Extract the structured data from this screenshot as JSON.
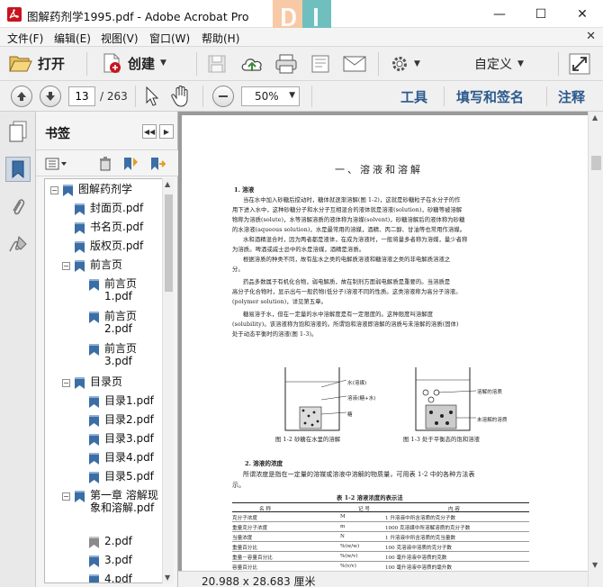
{
  "window": {
    "title": "图解药剂学1995.pdf - Adobe Acrobat Pro",
    "minimize": "—",
    "maximize": "☐",
    "close": "✕"
  },
  "menu": {
    "items": [
      "文件(F)",
      "编辑(E)",
      "视图(V)",
      "窗口(W)",
      "帮助(H)"
    ],
    "close": "✕"
  },
  "toolbar": {
    "open_label": "打开",
    "create_label": "创建",
    "customize_label": "自定义"
  },
  "nav": {
    "page_current": "13",
    "page_total": "/ 263",
    "zoom": "50%",
    "tools_label": "工具",
    "fill_sign_label": "填写和签名",
    "comment_label": "注释"
  },
  "bookmarks": {
    "title": "书签",
    "items": [
      {
        "label": "图解药剂学",
        "toggle": "−"
      },
      {
        "label": "封面页.pdf",
        "toggle": ""
      },
      {
        "label": "书名页.pdf",
        "toggle": ""
      },
      {
        "label": "版权页.pdf",
        "toggle": ""
      },
      {
        "label": "前言页",
        "toggle": "−"
      },
      {
        "label": "前言页 1.pdf",
        "toggle": ""
      },
      {
        "label": "前言页 2.pdf",
        "toggle": ""
      },
      {
        "label": "前言页 3.pdf",
        "toggle": ""
      },
      {
        "label": "目录页",
        "toggle": "−"
      },
      {
        "label": "目录1.pdf",
        "toggle": ""
      },
      {
        "label": "目录2.pdf",
        "toggle": ""
      },
      {
        "label": "目录3.pdf",
        "toggle": ""
      },
      {
        "label": "目录4.pdf",
        "toggle": ""
      },
      {
        "label": "目录5.pdf",
        "toggle": ""
      },
      {
        "label": "第一章 溶解现象和溶解.pdf",
        "toggle": "−"
      },
      {
        "label": "2.pdf",
        "toggle": ""
      },
      {
        "label": "3.pdf",
        "toggle": ""
      },
      {
        "label": "4.pdf",
        "toggle": ""
      }
    ]
  },
  "document": {
    "title": "一、溶液和溶解",
    "sec1": "1. 溶液",
    "para1": [
      "当在水中加入砂糖后搅动时，糖体就逐渐溶解(图 1-2)，这就是砂糖粒子在水分子的作",
      "用下进入水中，这种砂糖分子和水分子互相混合的液体就是溶液(solution)，砂糖等被溶解",
      "物称为溶质(solute)，水等溶解溶质的液体称为溶媒(solvent)，砂糖溶解后的液体称为砂糖",
      "的水溶液(aqueous solution)，水是最常用的溶媒，酒精、丙二醇、甘油等也常用作溶媒。",
      "水和酒精混合时，因为两者都是液体，在成为溶液时，一般将量多者称为溶媒，量少者称",
      "为溶质。啤酒或威士忌中的水是溶媒，酒精是溶质。",
      "根据溶质的种类不同，故有盐水之类的电解质溶液和糖溶液之类的非电解质溶液之",
      "分。",
      "药品多数属于有机化合物，弱电解质，故在制剂方面弱电解质是重要的。当溶质是",
      "高分子化合物时，显示出与一般药物(低分子)溶液不同的性质。这类溶液称为高分子溶液。",
      "(polymer solution)，详见第五章。",
      "糖易溶于水，但在一定量的水中溶解度是有一定限度的。这种限度叫溶解度",
      "(solubility)。该溶液称为饱和溶液的。所谓饱和溶液即溶解的溶质与未溶解的溶质(固体)",
      "处于动态平衡时的溶液(图 1-3)。"
    ],
    "fig1_legend": [
      "水(溶媒)",
      "溶液(糖+水)",
      "糖"
    ],
    "fig2_legend": [
      "溶解的溶质",
      "未溶解的溶质"
    ],
    "fig1_caption": "图 1-2  砂糖在水里的溶解",
    "fig2_caption": "图 1-3  处于平衡态的饱和溶液",
    "sec2": "2. 溶液的浓度",
    "para2": [
      "所谓浓度是指在一定量的溶媒或溶液中溶解的物质量，可用表 1-2 中的各种方法表",
      "示。"
    ],
    "table_title": "表 1-2  溶液浓度的表示法",
    "table_headers": [
      "名  称",
      "记  号",
      "内  容"
    ],
    "table_rows": [
      [
        "克分子浓度",
        "M",
        "1 升溶液中所含溶质的克分子数"
      ],
      [
        "重量克分子浓度",
        "m",
        "1000 克溶媒中所溶解溶质的克分子数"
      ],
      [
        "当量浓度",
        "N",
        "1 升溶液中所含溶质的克当量数"
      ],
      [
        "重量百分比",
        "%(w/w)",
        "100 克溶液中溶质的克分子数"
      ],
      [
        "重量－容量百分比",
        "%(w/v)",
        "100 毫升溶液中溶质的克数"
      ],
      [
        "容量百分比",
        "%(v/v)",
        "100 毫升溶液中溶质的毫升数"
      ]
    ]
  },
  "status": {
    "page_size": "20.988 x 28.683 厘米"
  },
  "colors": {
    "accent_link": "#2b5a8e",
    "bookmark_icon": "#3b6ea5",
    "pdf_red": "#c8141e"
  }
}
